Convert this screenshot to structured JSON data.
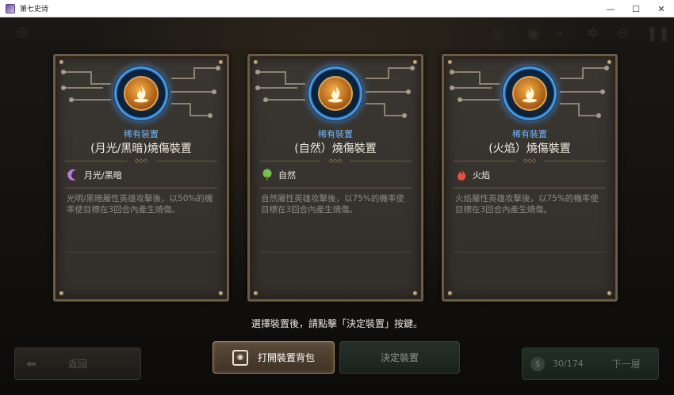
{
  "window": {
    "title": "第七史诗",
    "minimize": "—",
    "maximize": "☐",
    "close": "✕"
  },
  "cards": [
    {
      "rarity": "稀有裝置",
      "title": "(月光/黑暗)燒傷裝置",
      "attribute": "月光/黑暗",
      "attribute_icon": "moon-dark-icon",
      "description": "光明/黑暗屬性英雄攻擊後，以50%的機率使目標在3回合內產生燒傷。"
    },
    {
      "rarity": "稀有裝置",
      "title": "(自然）燒傷裝置",
      "attribute": "自然",
      "attribute_icon": "tree-icon",
      "description": "自然屬性英雄攻擊後，以75%的機率使目標在3回合內產生燒傷。"
    },
    {
      "rarity": "稀有裝置",
      "title": "(火焰）燒傷裝置",
      "attribute": "火焰",
      "attribute_icon": "flame-icon",
      "description": "火焰屬性英雄攻擊後，以75%的機率使目標在3回合內產生燒傷。"
    }
  ],
  "instruction": "選擇裝置後，請點擊「決定裝置」按鍵。",
  "buttons": {
    "back": "返回",
    "open_bag": "打開裝置背包",
    "confirm": "決定裝置",
    "next_floor": "下一層",
    "resource_count": "30/174"
  },
  "colors": {
    "rarity": "#6fb6ff",
    "card_border": "#6e5a3e",
    "emblem_glow": "#5bb0ff"
  }
}
